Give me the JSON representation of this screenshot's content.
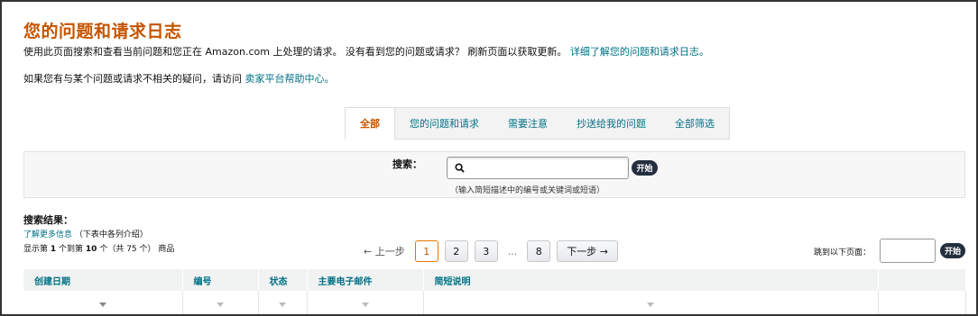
{
  "page": {
    "title": "您的问题和请求日志",
    "intro_text": "使用此页面搜索和查看当前问题和您正在 Amazon.com 上处理的请求。 没有看到您的问题或请求？ 刷新页面以获取更新。",
    "intro_link": "详细了解您的问题和请求日志。",
    "help_text": "如果您有与某个问题或请求不相关的疑问，请访问",
    "help_link": "卖家平台帮助中心。"
  },
  "tabs": [
    {
      "label": "全部",
      "active": true
    },
    {
      "label": "您的问题和请求"
    },
    {
      "label": "需要注意"
    },
    {
      "label": "抄送给我的问题"
    },
    {
      "label": "全部筛选"
    }
  ],
  "search": {
    "label": "搜索：",
    "placeholder": "",
    "button": "开始",
    "hint": "（输入简短描述中的编号或关键词或短语）"
  },
  "results": {
    "title": "搜索结果：",
    "more_info_link": "了解更多信息",
    "more_info_note": "（下表中各列介绍）",
    "count_prefix": "显示第",
    "count_from": "1",
    "count_mid": "个到第",
    "count_to": "10",
    "count_total_text": "个（共 75 个） 商品"
  },
  "pagination": {
    "prev": "上一步",
    "pages": [
      "1",
      "2",
      "3"
    ],
    "ellipsis": "...",
    "last": "8",
    "next": "下一步",
    "jump_label": "跳到以下页面：",
    "jump_button": "开始"
  },
  "table": {
    "columns": [
      "创建日期",
      "编号",
      "状态",
      "主要电子邮件",
      "简短说明",
      ""
    ]
  }
}
